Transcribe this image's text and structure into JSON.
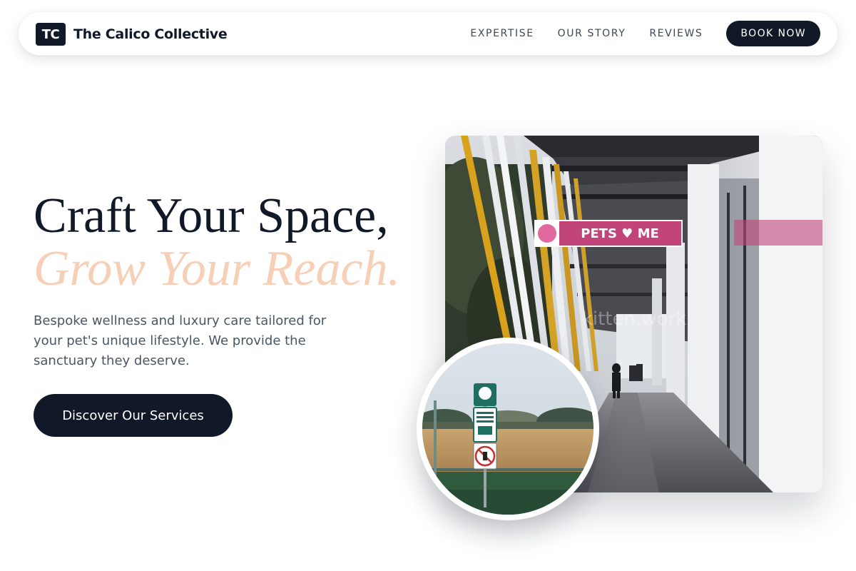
{
  "brand": {
    "logo_initials": "TC",
    "name": "The Calico Collective"
  },
  "nav": {
    "links": [
      "EXPERTISE",
      "OUR STORY",
      "REVIEWS"
    ],
    "cta_label": "BOOK NOW"
  },
  "hero": {
    "headline_line1": "Craft Your Space,",
    "headline_line2": "Grow Your Reach.",
    "subcopy": "Bespoke wellness and luxury care tailored for your pet's unique lifestyle. We provide the sanctuary they deserve.",
    "cta_label": "Discover Our Services"
  },
  "images": {
    "main_sign_text": "PETS ♥ ME",
    "main_watermark": "kitten.work",
    "circle_sign_text": "Please leash and clean up after your dog"
  },
  "colors": {
    "primary": "#111827",
    "accent": "#f6cfb6",
    "body_text": "#4b5563",
    "nav_text": "#3f4654",
    "background": "#ffffff"
  }
}
